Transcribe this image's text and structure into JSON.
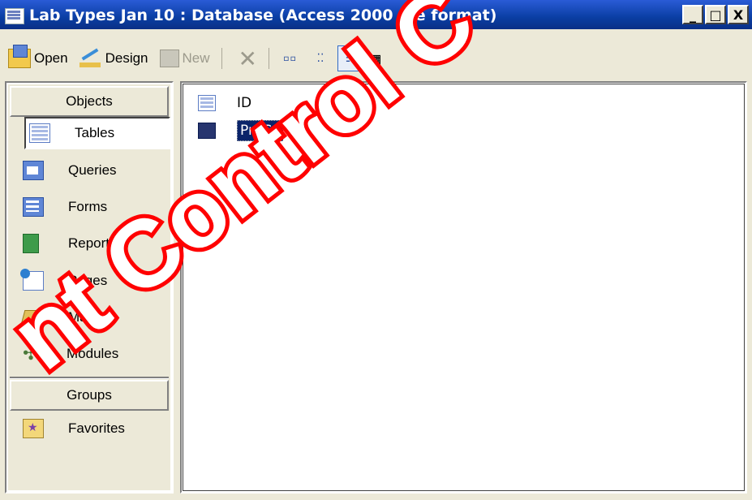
{
  "window": {
    "title": "Lab Types Jan 10 : Database (Access 2000 file format)",
    "min_label": "_",
    "max_label": "□",
    "close_label": "X"
  },
  "toolbar": {
    "open_label": "Open",
    "design_label": "Design",
    "new_label": "New",
    "delete_icon": "delete-icon",
    "views": [
      "large-icons-view",
      "small-icons-view",
      "list-view",
      "details-view"
    ]
  },
  "objects_pane": {
    "objects_header": "Objects",
    "items": [
      {
        "label": "Tables",
        "icon": "tables-icon",
        "selected": true
      },
      {
        "label": "Queries",
        "icon": "queries-icon"
      },
      {
        "label": "Forms",
        "icon": "forms-icon"
      },
      {
        "label": "Reports",
        "icon": "reports-icon"
      },
      {
        "label": "Pages",
        "icon": "pages-icon"
      },
      {
        "label": "Macros",
        "icon": "macros-icon"
      },
      {
        "label": "Modules",
        "icon": "modules-icon"
      }
    ],
    "groups_header": "Groups",
    "groups": [
      {
        "label": "Favorites",
        "icon": "favorites-icon"
      }
    ]
  },
  "list_pane": {
    "items": [
      {
        "label": "ID",
        "icon": "table-icon"
      },
      {
        "label": "ProCo",
        "icon": "linked-table-icon",
        "selected": true
      }
    ]
  },
  "watermark": {
    "text": "nt Control C",
    "color": "#FF0000"
  }
}
